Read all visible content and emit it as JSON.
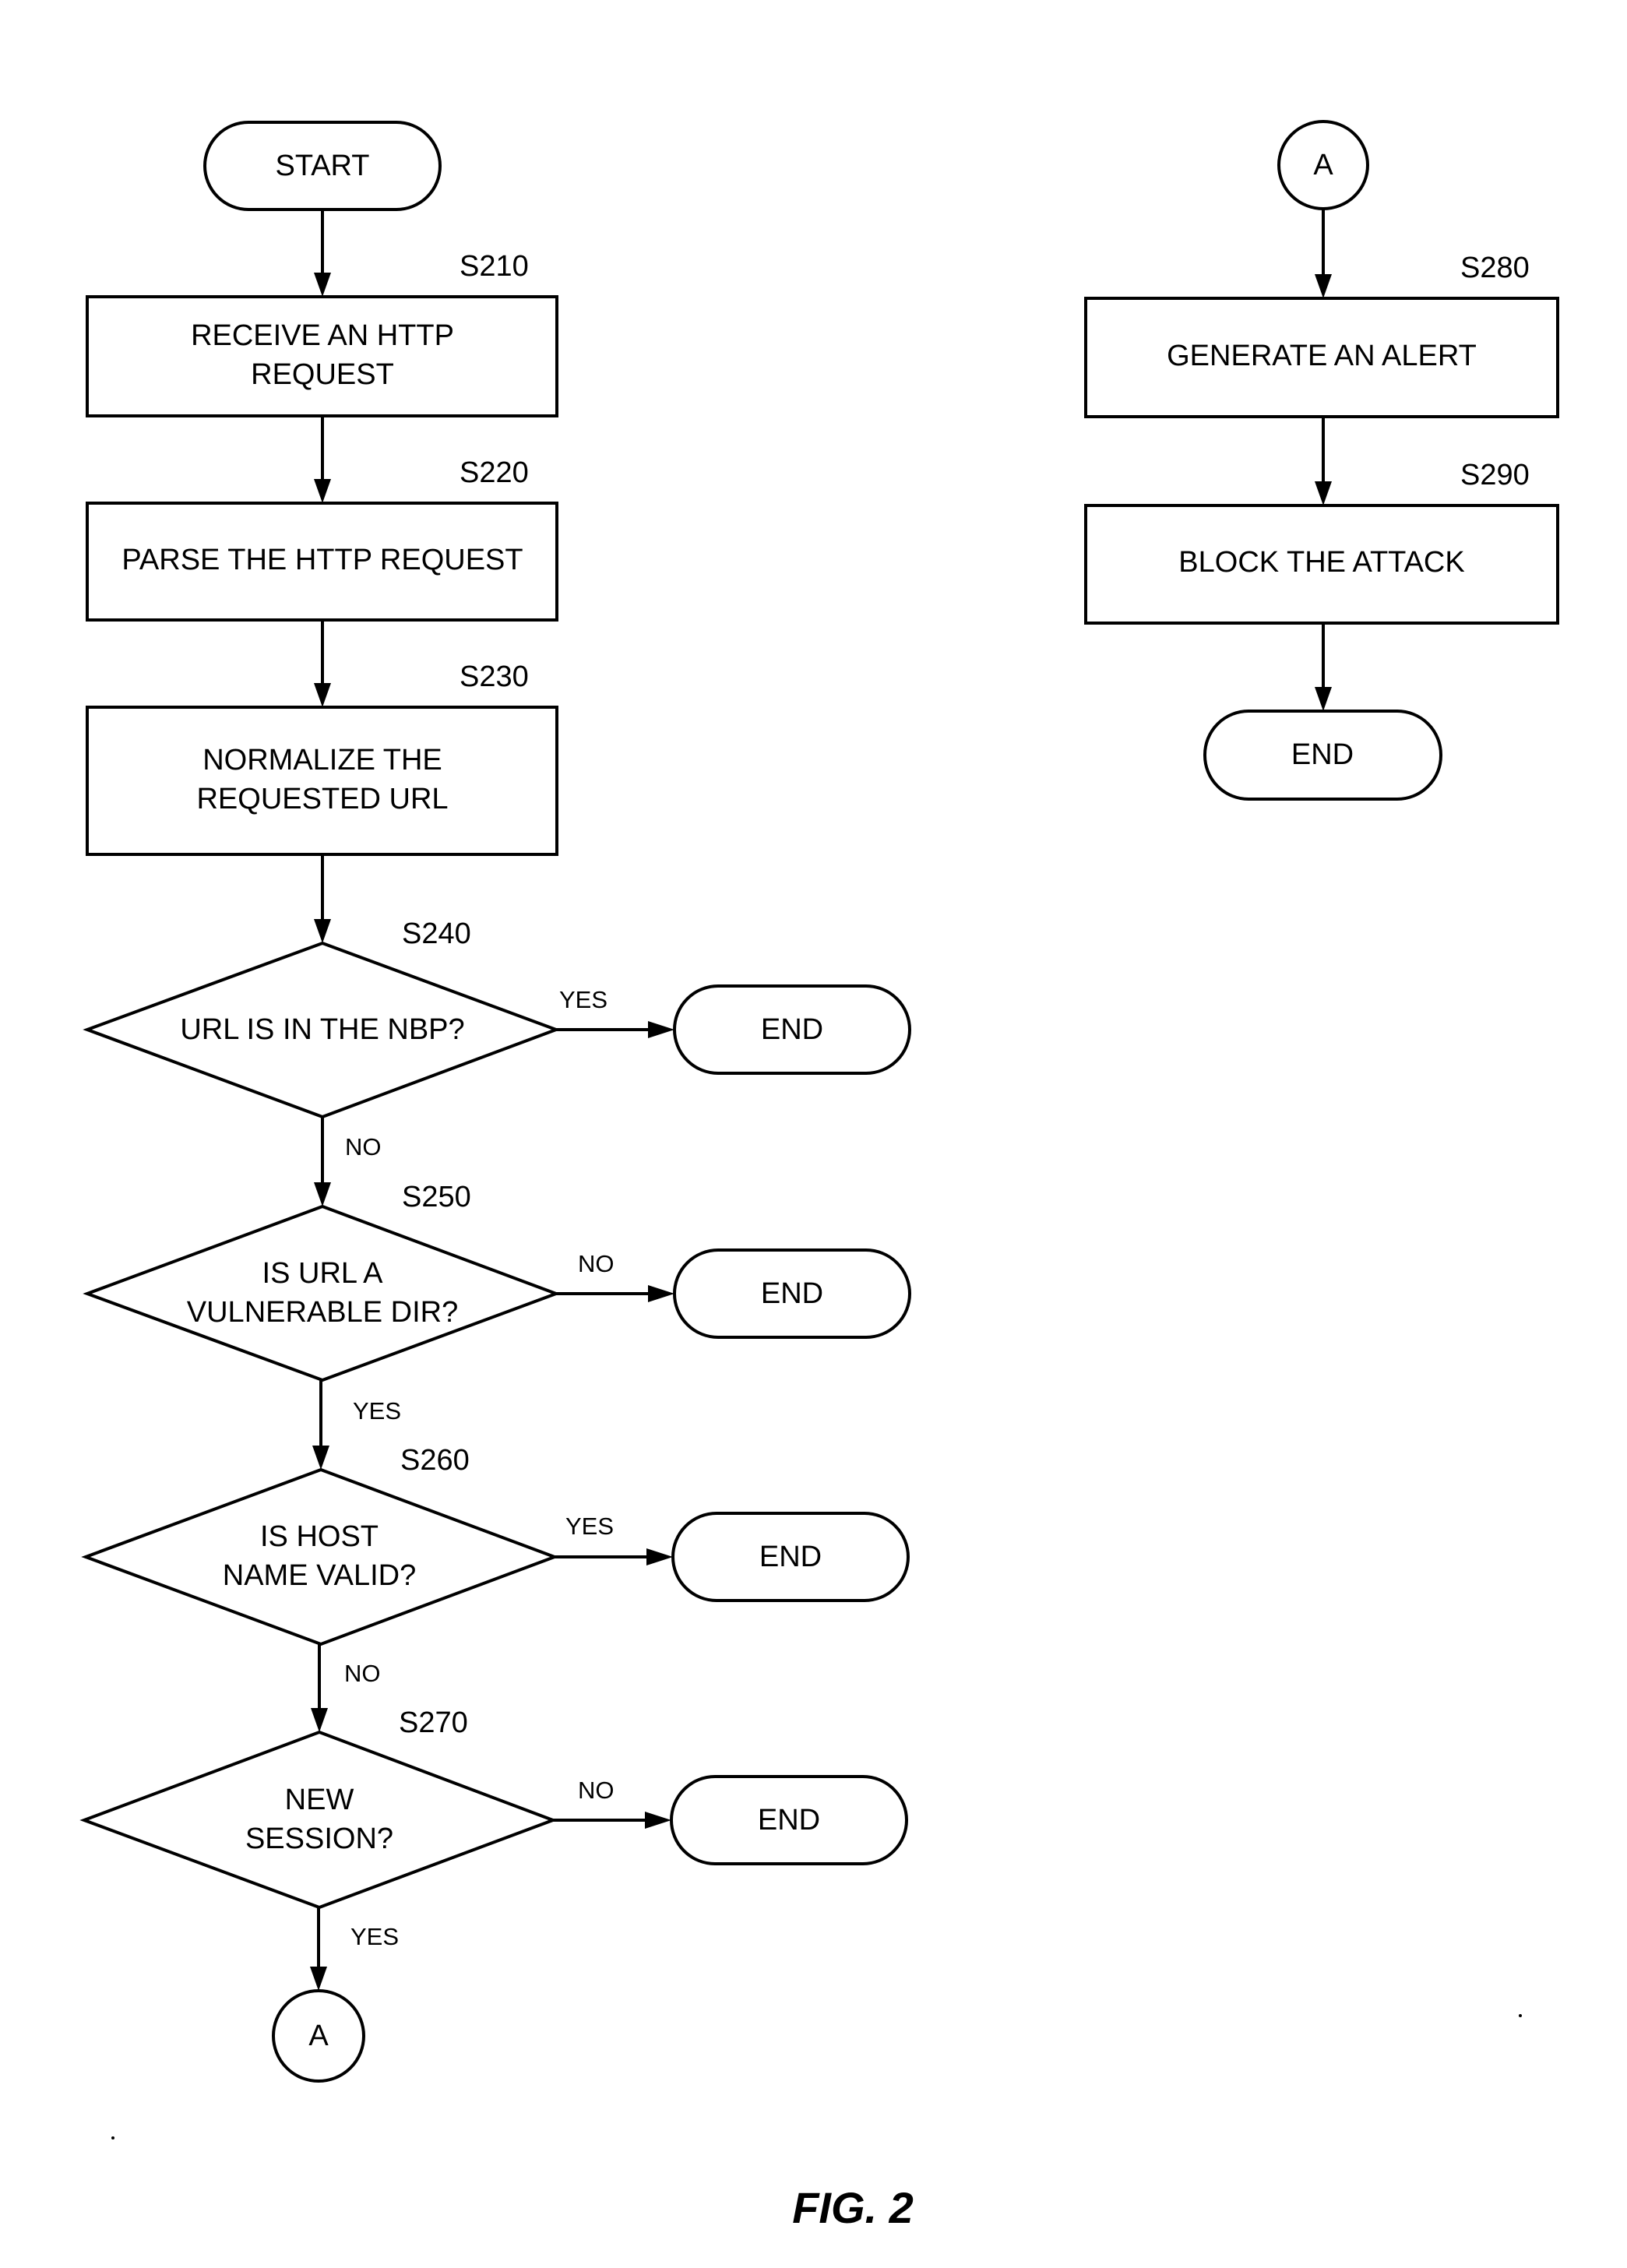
{
  "figure": {
    "caption": "FIG. 2",
    "left_flow": {
      "start": {
        "label": "START"
      },
      "steps": [
        {
          "id": "S210",
          "lines": [
            "RECEIVE AN HTTP",
            "REQUEST"
          ]
        },
        {
          "id": "S220",
          "lines": [
            "PARSE THE HTTP REQUEST"
          ]
        },
        {
          "id": "S230",
          "lines": [
            "NORMALIZE THE",
            "REQUESTED URL"
          ]
        }
      ],
      "decisions": [
        {
          "id": "S240",
          "lines": [
            "URL IS IN THE NBP?"
          ],
          "exit_right": "YES",
          "exit_down": "NO",
          "end_label": "END"
        },
        {
          "id": "S250",
          "lines": [
            "IS URL A",
            "VULNERABLE DIR?"
          ],
          "exit_right": "NO",
          "exit_down": "YES",
          "end_label": "END"
        },
        {
          "id": "S260",
          "lines": [
            "IS HOST",
            "NAME VALID?"
          ],
          "exit_right": "YES",
          "exit_down": "NO",
          "end_label": "END"
        },
        {
          "id": "S270",
          "lines": [
            "NEW",
            "SESSION?"
          ],
          "exit_right": "NO",
          "exit_down": "YES",
          "end_label": "END"
        }
      ],
      "connector": {
        "label": "A"
      }
    },
    "right_flow": {
      "connector": {
        "label": "A"
      },
      "steps": [
        {
          "id": "S280",
          "lines": [
            "GENERATE AN ALERT"
          ]
        },
        {
          "id": "S290",
          "lines": [
            "BLOCK THE ATTACK"
          ]
        }
      ],
      "end": {
        "label": "END"
      }
    }
  }
}
